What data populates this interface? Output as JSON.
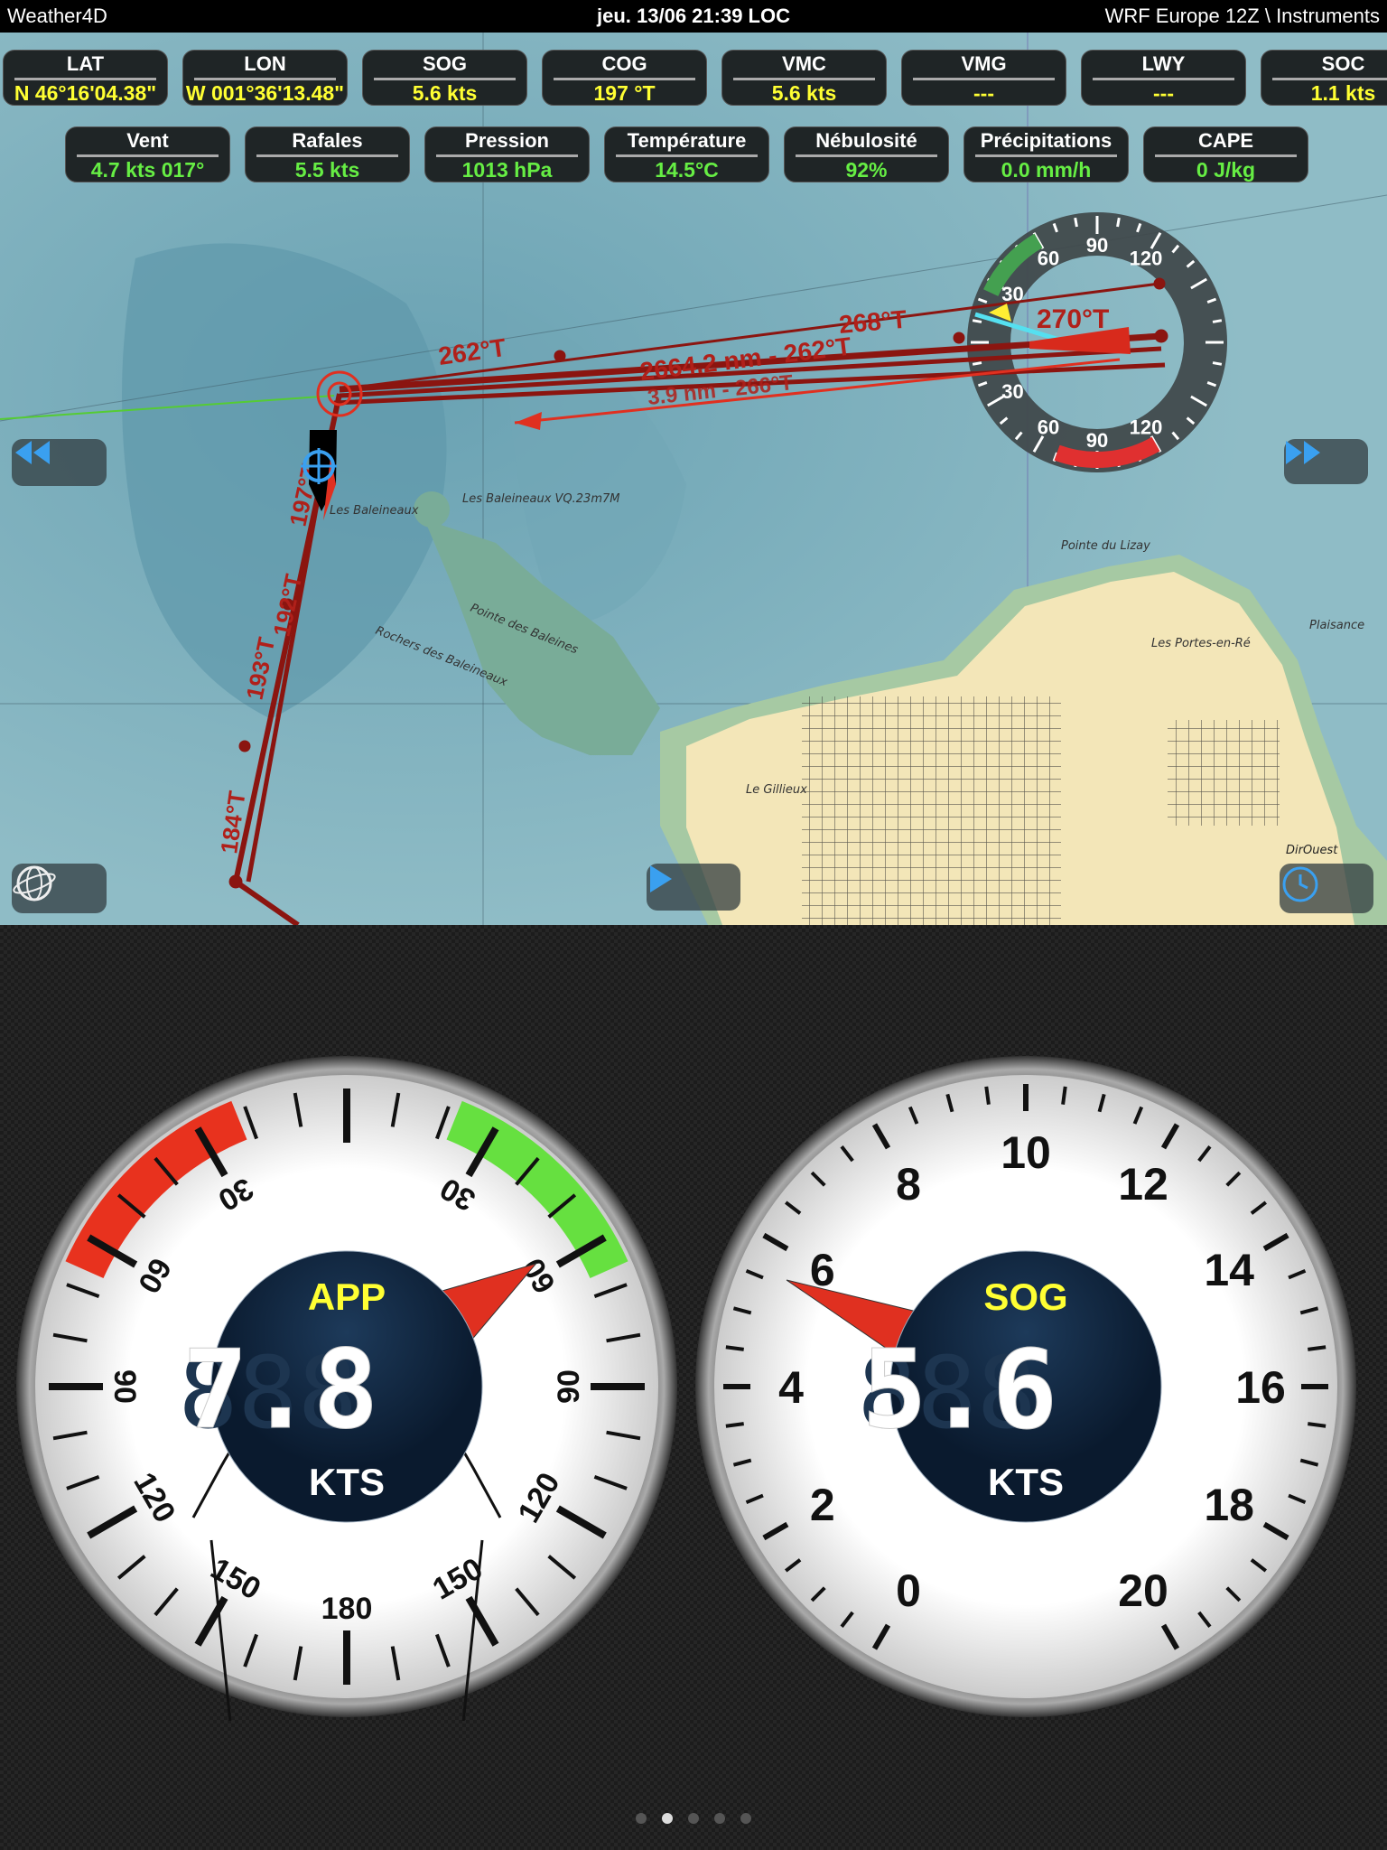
{
  "topbar": {
    "app": "Weather4D",
    "datetime": "jeu. 13/06 21:39 LOC",
    "source": "WRF Europe 12Z \\ Instruments"
  },
  "nav_data": [
    {
      "label": "LAT",
      "value": "N  46°16'04.38\""
    },
    {
      "label": "LON",
      "value": "W 001°36'13.48\""
    },
    {
      "label": "SOG",
      "value": "5.6 kts"
    },
    {
      "label": "COG",
      "value": "197 °T"
    },
    {
      "label": "VMC",
      "value": "5.6 kts"
    },
    {
      "label": "VMG",
      "value": "---"
    },
    {
      "label": "LWY",
      "value": "---"
    },
    {
      "label": "SOC",
      "value": "1.1 kts"
    }
  ],
  "weather_data": [
    {
      "label": "Vent",
      "value": "4.7 kts 017°"
    },
    {
      "label": "Rafales",
      "value": "5.5 kts"
    },
    {
      "label": "Pression",
      "value": "1013 hPa"
    },
    {
      "label": "Température",
      "value": "14.5°C"
    },
    {
      "label": "Nébulosité",
      "value": "92%"
    },
    {
      "label": "Précipitations",
      "value": "0.0 mm/h"
    },
    {
      "label": "CAPE",
      "value": "0 J/kg"
    }
  ],
  "map": {
    "route_labels": {
      "leg1": "262°T",
      "leg_main": "2664.2 nm - 262°T",
      "leg_sub": "3.9 nm - 266°T",
      "leg3": "268°T",
      "heading": "270°T",
      "south1": "197°T",
      "south2": "193°T",
      "south3": "192°T",
      "south4": "184°T"
    },
    "chart_labels": {
      "baleineaux": "Les Baleineaux",
      "light": "Les Baleineaux VQ.23m7M",
      "pointe_baleines": "Pointe des Baleines",
      "rochers": "Rochers des Baleineaux",
      "lizay": "Pointe du Lizay",
      "portes": "Les Portes-en-Ré",
      "gillieux": "Le Gillieux",
      "plaisance": "Plaisance",
      "dir": "DirOuest"
    },
    "compass_labels": [
      "90",
      "120",
      "60",
      "30",
      "30",
      "60",
      "90",
      "120"
    ],
    "route_color": "#8b1510",
    "buttons": {
      "rewind": "rewind-icon",
      "forward": "fast-forward-icon",
      "globe": "globe-icon",
      "play": "play-icon",
      "clock": "clock-icon"
    }
  },
  "gauges": {
    "wind": {
      "title": "APP",
      "value": "7.8",
      "ghost": "888",
      "unit": "KTS",
      "angle_deg": 57,
      "labels": [
        "30",
        "60",
        "90",
        "120",
        "150",
        "180",
        "150",
        "120",
        "90",
        "60",
        "30"
      ],
      "port_color": "#e8321e",
      "starboard_color": "#66e040"
    },
    "sog": {
      "title": "SOG",
      "value": "5.6",
      "ghost": "888",
      "unit": "KTS",
      "speed": 5.6,
      "min": 0,
      "max": 20,
      "labels": [
        "0",
        "2",
        "4",
        "6",
        "8",
        "10",
        "12",
        "14",
        "16",
        "18",
        "20"
      ]
    }
  },
  "pager": {
    "count": 5,
    "active": 1
  }
}
